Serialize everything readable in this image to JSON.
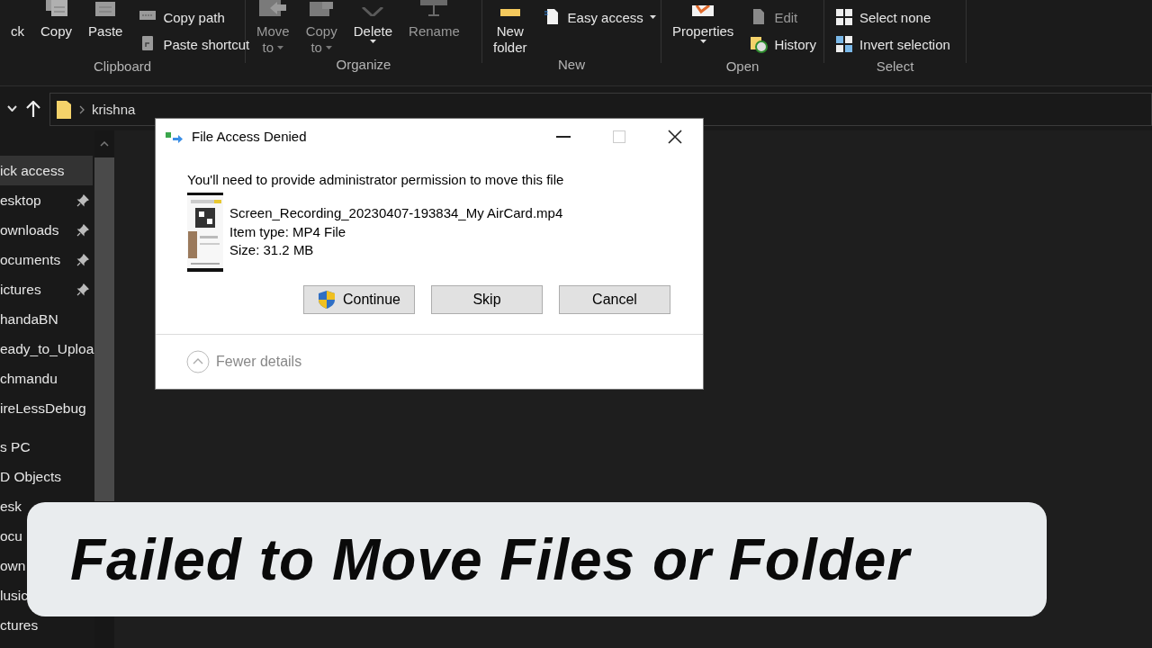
{
  "ribbon": {
    "groups": [
      {
        "label": "Clipboard",
        "items": [
          {
            "kind": "large",
            "lines": [
              "ck"
            ],
            "disabled": false,
            "dropdown": false
          },
          {
            "kind": "large",
            "lines": [
              "Copy"
            ],
            "disabled": false,
            "dropdown": false
          },
          {
            "kind": "large",
            "lines": [
              "Paste"
            ],
            "disabled": false,
            "dropdown": false
          },
          {
            "kind": "stack",
            "items": [
              {
                "label": "Copy path",
                "disabled": false
              },
              {
                "label": "Paste shortcut",
                "disabled": false
              }
            ]
          }
        ]
      },
      {
        "label": "Organize",
        "items": [
          {
            "kind": "large",
            "lines": [
              "Move",
              "to"
            ],
            "disabled": true,
            "dropdown": true
          },
          {
            "kind": "large",
            "lines": [
              "Copy",
              "to"
            ],
            "disabled": true,
            "dropdown": true
          },
          {
            "kind": "large",
            "lines": [
              "Delete"
            ],
            "disabled": false,
            "dropdown": true
          },
          {
            "kind": "large",
            "lines": [
              "Rename"
            ],
            "disabled": true,
            "dropdown": false
          }
        ]
      },
      {
        "label": "New",
        "items": [
          {
            "kind": "large",
            "lines": [
              "New",
              "folder"
            ],
            "disabled": false,
            "dropdown": false
          },
          {
            "kind": "stack",
            "items": [
              {
                "label": "Easy access",
                "disabled": false,
                "dropdown": true
              }
            ]
          }
        ]
      },
      {
        "label": "Open",
        "items": [
          {
            "kind": "large",
            "lines": [
              "Properties"
            ],
            "disabled": false,
            "dropdown": true
          },
          {
            "kind": "stack",
            "items": [
              {
                "label": "Edit",
                "disabled": true
              },
              {
                "label": "History",
                "disabled": false
              }
            ]
          }
        ]
      },
      {
        "label": "Select",
        "items": [
          {
            "kind": "stack",
            "items": [
              {
                "label": "Select none",
                "disabled": false
              },
              {
                "label": "Invert selection",
                "disabled": false
              }
            ]
          }
        ]
      }
    ]
  },
  "address_bar": {
    "path": "krishna"
  },
  "sidebar": {
    "sections": [
      {
        "label": "ick access",
        "selected": true,
        "children": [
          {
            "label": "esktop",
            "pinned": true
          },
          {
            "label": "ownloads",
            "pinned": true
          },
          {
            "label": "ocuments",
            "pinned": true
          },
          {
            "label": "ictures",
            "pinned": true
          },
          {
            "label": "handaBN",
            "pinned": false
          },
          {
            "label": "eady_to_Uploa",
            "pinned": false
          },
          {
            "label": "chmandu",
            "pinned": false
          },
          {
            "label": "ireLessDebug",
            "pinned": false
          }
        ]
      },
      {
        "label": "s PC",
        "selected": false,
        "children": [
          {
            "label": "D Objects",
            "pinned": false
          },
          {
            "label": "esk",
            "pinned": false
          },
          {
            "label": "ocu",
            "pinned": false
          },
          {
            "label": "own",
            "pinned": false
          },
          {
            "label": "lusic",
            "pinned": false
          },
          {
            "label": "ctures",
            "pinned": false
          }
        ]
      }
    ]
  },
  "dialog": {
    "title": "File Access Denied",
    "message": "You'll need to provide administrator permission to move this file",
    "file": {
      "name": "Screen_Recording_20230407-193834_My AirCard.mp4",
      "type": "Item type: MP4 File",
      "size": "Size: 31.2 MB"
    },
    "buttons": [
      {
        "label": "Continue",
        "shield": true
      },
      {
        "label": "Skip",
        "shield": false
      },
      {
        "label": "Cancel",
        "shield": false
      }
    ],
    "details_toggle": "Fewer details"
  },
  "caption": "Failed to Move Files or Folder"
}
